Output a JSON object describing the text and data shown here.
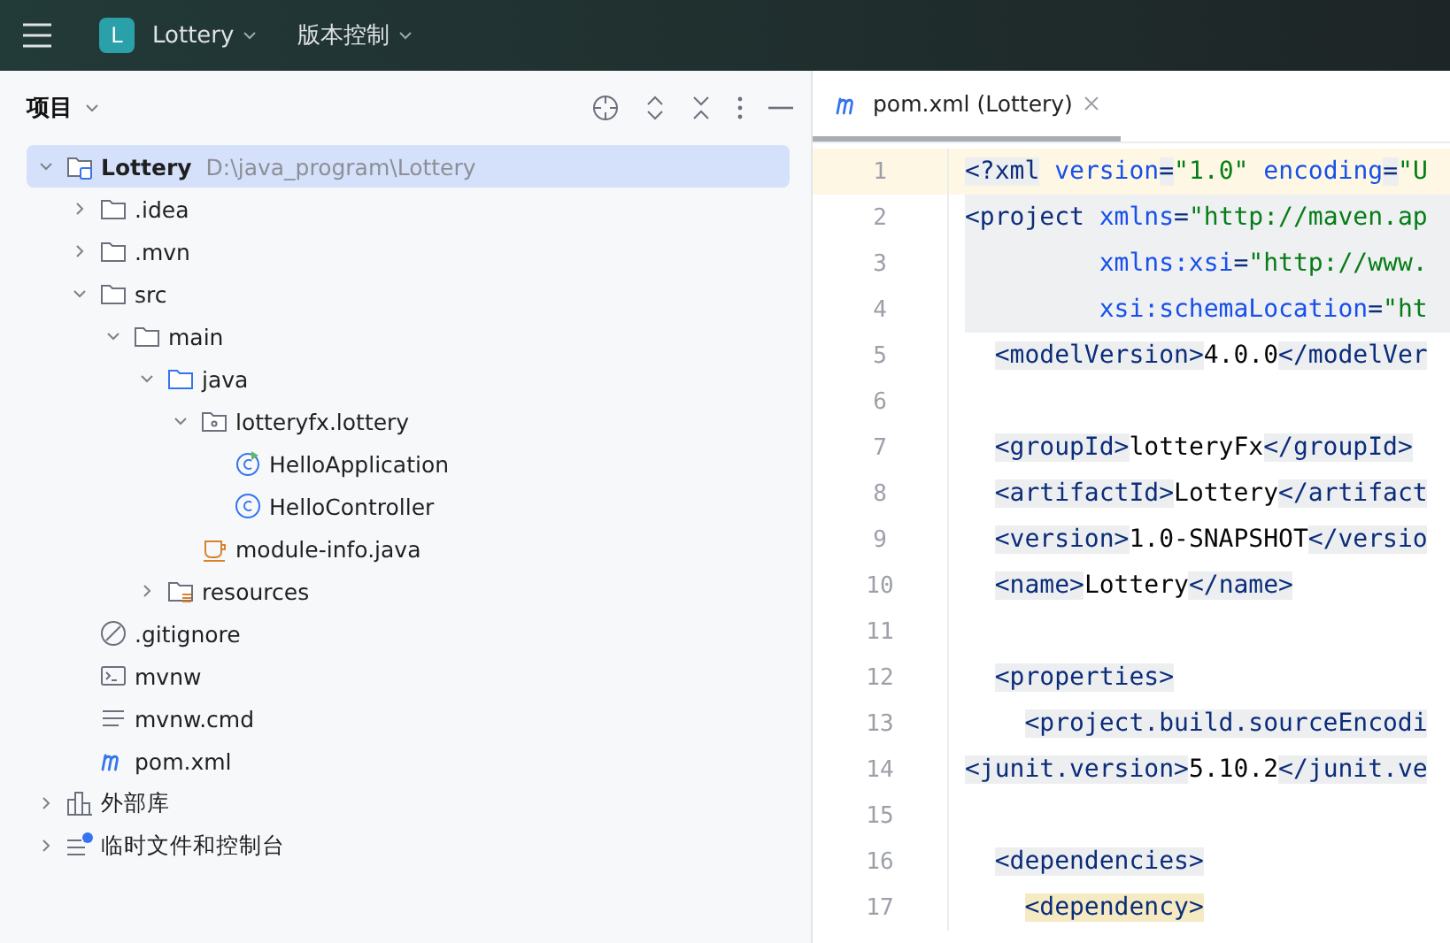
{
  "topbar": {
    "project_badge": "L",
    "project": "Lottery",
    "vcs": "版本控制"
  },
  "project_panel": {
    "title": "项目",
    "tree": [
      {
        "name": "Lottery",
        "path": "D:\\java_program\\Lottery",
        "kind": "module",
        "expanded": true,
        "selected": true,
        "children": [
          {
            "name": ".idea",
            "kind": "folder",
            "expanded": false,
            "selected": false
          },
          {
            "name": ".mvn",
            "kind": "folder",
            "expanded": false,
            "selected": false
          },
          {
            "name": "src",
            "kind": "folder",
            "expanded": true,
            "selected": false,
            "children": [
              {
                "name": "main",
                "kind": "folder",
                "expanded": true,
                "selected": false,
                "children": [
                  {
                    "name": "java",
                    "kind": "source",
                    "expanded": true,
                    "selected": false,
                    "children": [
                      {
                        "name": "lotteryfx.lottery",
                        "kind": "package",
                        "expanded": true,
                        "selected": false,
                        "children": [
                          {
                            "name": "HelloApplication",
                            "kind": "app",
                            "selected": false
                          },
                          {
                            "name": "HelloController",
                            "kind": "class",
                            "selected": false
                          }
                        ]
                      },
                      {
                        "name": "module-info.java",
                        "kind": "javafile",
                        "selected": false
                      }
                    ]
                  },
                  {
                    "name": "resources",
                    "kind": "resources",
                    "expanded": false,
                    "selected": false
                  }
                ]
              }
            ]
          },
          {
            "name": ".gitignore",
            "kind": "ignore",
            "selected": false
          },
          {
            "name": "mvnw",
            "kind": "shell",
            "selected": false
          },
          {
            "name": "mvnw.cmd",
            "kind": "text",
            "selected": false
          },
          {
            "name": "pom.xml",
            "kind": "maven",
            "selected": false
          }
        ]
      },
      {
        "name": "外部库",
        "kind": "library",
        "expanded": false,
        "selected": false
      },
      {
        "name": "临时文件和控制台",
        "kind": "scratch",
        "expanded": false,
        "selected": false
      }
    ]
  },
  "editor": {
    "tabs": [
      {
        "label": "pom.xml (Lottery)",
        "selected": true
      }
    ],
    "lines": [
      {
        "number": "1",
        "kind": "current",
        "code": "<?xml version=\"1.0\" encoding=\"U"
      },
      {
        "number": "2",
        "kind": "block",
        "code": "<project xmlns=\"http://maven.ap"
      },
      {
        "number": "3",
        "kind": "block",
        "code": "         xmlns:xsi=\"http://www."
      },
      {
        "number": "4",
        "kind": "block",
        "code": "         xsi:schemaLocation=\"ht"
      },
      {
        "number": "5",
        "kind": "plain",
        "code": "  <modelVersion>4.0.0</modelVer"
      },
      {
        "number": "6",
        "kind": "plain"
      },
      {
        "number": "7",
        "kind": "plain",
        "code": "  <groupId>lotteryFx</groupId>"
      },
      {
        "number": "8",
        "kind": "plain",
        "code": "  <artifactId>Lottery</artifact"
      },
      {
        "number": "9",
        "kind": "plain",
        "code": "  <version>1.0-SNAPSHOT</versio"
      },
      {
        "number": "10",
        "kind": "plain",
        "code": "  <name>Lottery</name>"
      },
      {
        "number": "11",
        "kind": "plain"
      },
      {
        "number": "12",
        "kind": "plain",
        "code": "  <properties>"
      },
      {
        "number": "13",
        "kind": "plain",
        "code": "    <project.build.sourceEncodi"
      },
      {
        "number": "14",
        "kind": "plain",
        "code": "<junit.version>5.10.2</junit.ve"
      },
      {
        "number": "15",
        "kind": "plain"
      },
      {
        "number": "16",
        "kind": "plain",
        "code": "  <dependencies>"
      },
      {
        "number": "17",
        "kind": "match",
        "code": "    <dependency>"
      }
    ]
  }
}
